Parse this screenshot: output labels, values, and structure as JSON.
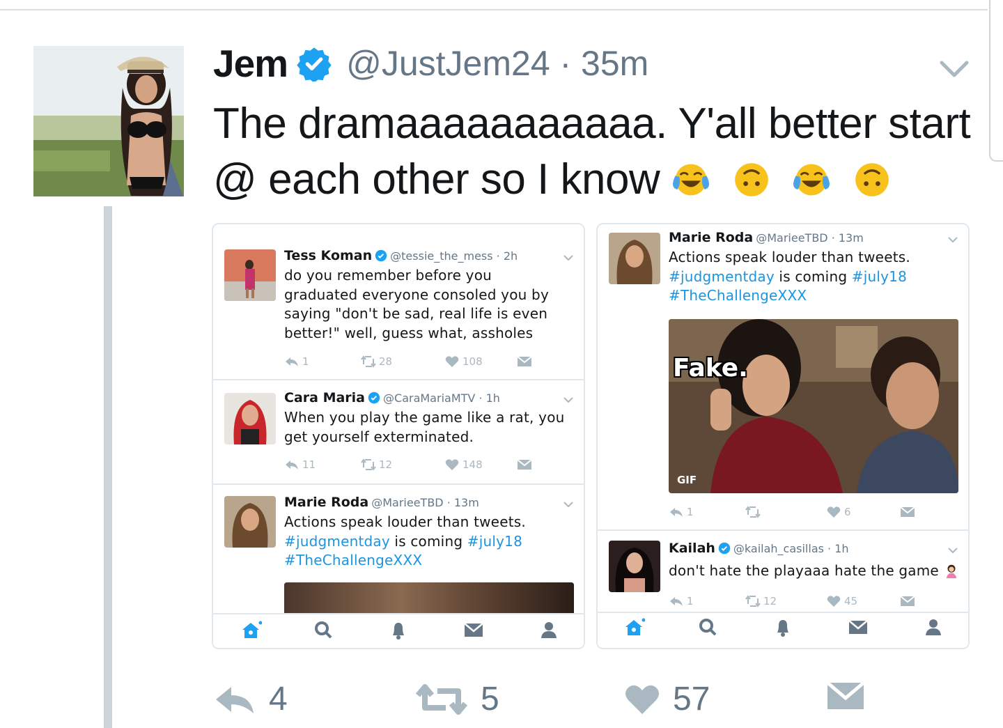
{
  "tweet": {
    "name": "Jem",
    "handle_time": "@JustJem24 · 35m",
    "text": "The dramaaaaaaaaaaa. Y'all better start @ each other so I know",
    "emojis": [
      "crying-laughing-face",
      "upside-down-face",
      "crying-laughing-face",
      "upside-down-face"
    ],
    "actions": {
      "replies": "4",
      "retweets": "5",
      "likes": "57"
    }
  },
  "left_panel": {
    "tweets": [
      {
        "name": "Tess Koman",
        "meta": "@tessie_the_mess · 2h",
        "text": "do you remember before you graduated everyone consoled you by saying \"don't be sad, real life is even better!\" well, guess what, assholes",
        "replies": "1",
        "retweets": "28",
        "likes": "108"
      },
      {
        "name": "Cara Maria",
        "meta": "@CaraMariaMTV · 1h",
        "text": "When you play the game like a rat, you get yourself exterminated.",
        "replies": "11",
        "retweets": "12",
        "likes": "148"
      },
      {
        "name": "Marie Roda",
        "meta": "@MarieeTBD · 13m",
        "text_plain": "Actions speak louder than tweets.",
        "tag1": "#judgmentday",
        "mid": " is coming ",
        "tag2": "#july18",
        "tag3": "#TheChallengeXXX"
      }
    ]
  },
  "right_panel": {
    "tweets": [
      {
        "name": "Marie Roda",
        "meta": "@MarieeTBD · 13m",
        "text_plain": "Actions speak louder than tweets.",
        "tag1": "#judgmentday",
        "mid": " is coming ",
        "tag2": "#july18",
        "tag3": "#TheChallengeXXX",
        "gif_caption": "Fake.",
        "gif_badge": "GIF",
        "replies": "1",
        "retweets": "",
        "likes": "6"
      },
      {
        "name": "Kailah",
        "meta": "@kailah_casillas · 1h",
        "text": "don't hate the playaaa hate the game",
        "replies": "1",
        "retweets": "12",
        "likes": "45"
      }
    ]
  },
  "colors": {
    "accent": "#1da1f2",
    "link": "#1b95e0",
    "muted": "#657786",
    "icon_light": "#aab8c2"
  }
}
